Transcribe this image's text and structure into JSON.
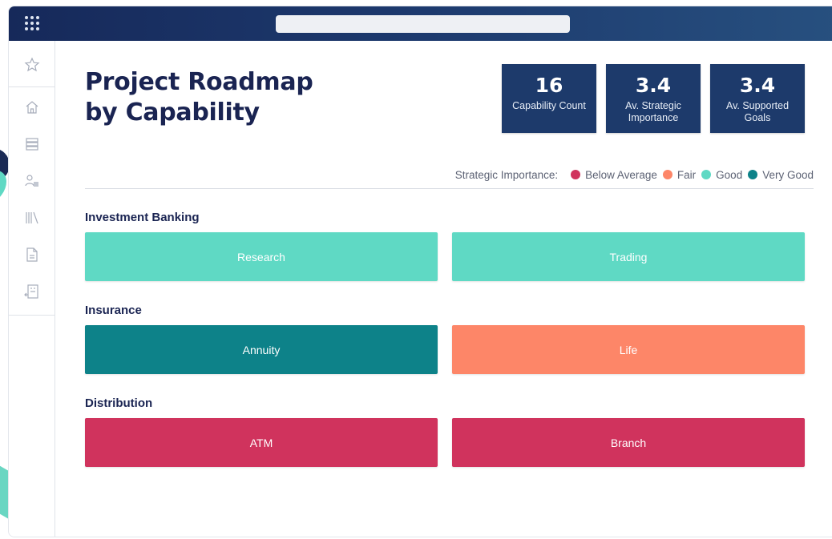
{
  "header": {
    "title_line1": "Project Roadmap",
    "title_line2": "by Capability"
  },
  "stats": [
    {
      "value": "16",
      "label": "Capability Count"
    },
    {
      "value": "3.4",
      "label": "Av. Strategic Importance"
    },
    {
      "value": "3.4",
      "label": "Av. Supported Goals"
    }
  ],
  "legend": {
    "title": "Strategic Importance:",
    "items": [
      {
        "label": "Below Average",
        "color": "#d0335d"
      },
      {
        "label": "Fair",
        "color": "#fd8668"
      },
      {
        "label": "Good",
        "color": "#5fd9c4"
      },
      {
        "label": "Very Good",
        "color": "#0d8289"
      }
    ]
  },
  "groups": [
    {
      "name": "Investment Banking",
      "capabilities": [
        {
          "label": "Research",
          "level": "Good",
          "color": "#5fd9c4"
        },
        {
          "label": "Trading",
          "level": "Good",
          "color": "#5fd9c4"
        }
      ]
    },
    {
      "name": "Insurance",
      "capabilities": [
        {
          "label": "Annuity",
          "level": "Very Good",
          "color": "#0d8289"
        },
        {
          "label": "Life",
          "level": "Fair",
          "color": "#fd8668"
        }
      ]
    },
    {
      "name": "Distribution",
      "capabilities": [
        {
          "label": "ATM",
          "level": "Below Average",
          "color": "#d0335d"
        },
        {
          "label": "Branch",
          "level": "Below Average",
          "color": "#d0335d"
        }
      ]
    }
  ],
  "sidebar": {
    "icons": [
      "star-icon",
      "home-icon",
      "database-icon",
      "users-icon",
      "library-icon",
      "document-icon",
      "report-icon"
    ]
  },
  "colors": {
    "topbar": "#16295a",
    "stat_bg": "#1d3a6b",
    "title": "#1a2452"
  }
}
